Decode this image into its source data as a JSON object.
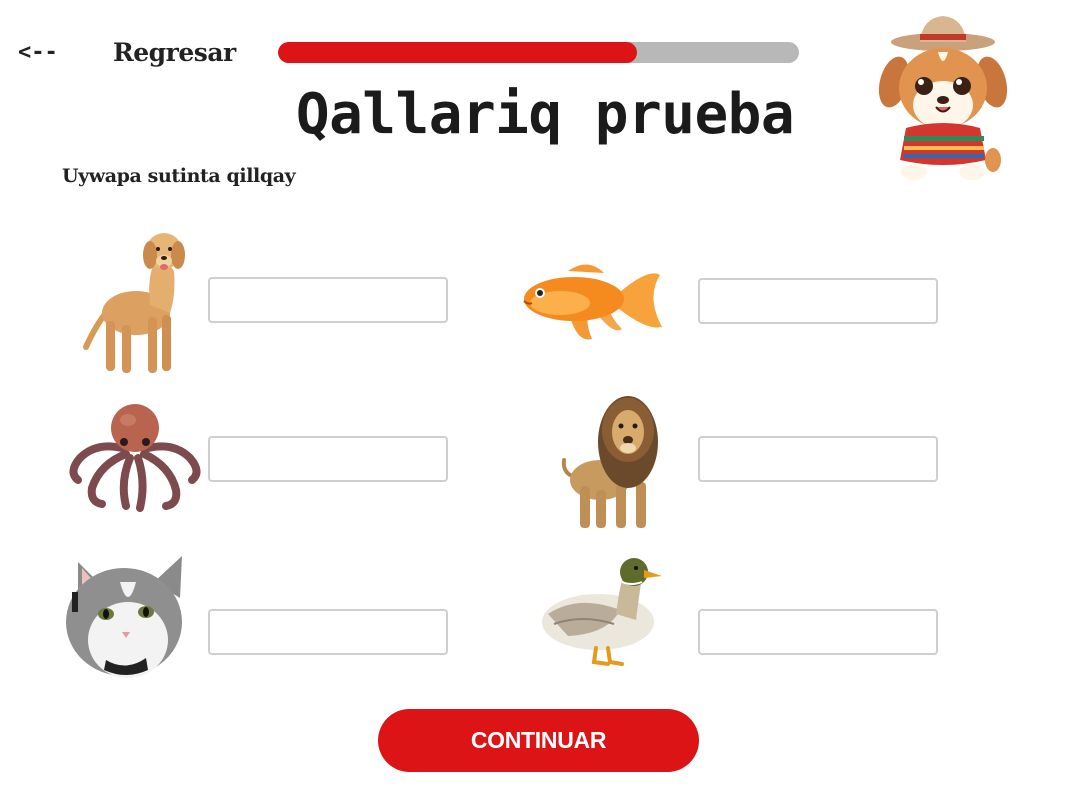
{
  "header": {
    "back_arrow": "<--",
    "back_label": "Regresar",
    "progress": 0.69,
    "progress_color": "#dd1416",
    "progress_track_color": "#b8b8b8"
  },
  "page": {
    "title": "Qallariq prueba",
    "instruction": "Uywapa sutinta qillqay"
  },
  "mascot": {
    "icon": "puppy-mascot-icon"
  },
  "quiz": {
    "items": [
      {
        "animal": "dog",
        "answer": ""
      },
      {
        "animal": "goldfish",
        "answer": ""
      },
      {
        "animal": "octopus",
        "answer": ""
      },
      {
        "animal": "lion",
        "answer": ""
      },
      {
        "animal": "cat",
        "answer": ""
      },
      {
        "animal": "duck",
        "answer": ""
      }
    ]
  },
  "footer": {
    "continue_label": "CONTINUAR",
    "accent": "#dc1416"
  }
}
